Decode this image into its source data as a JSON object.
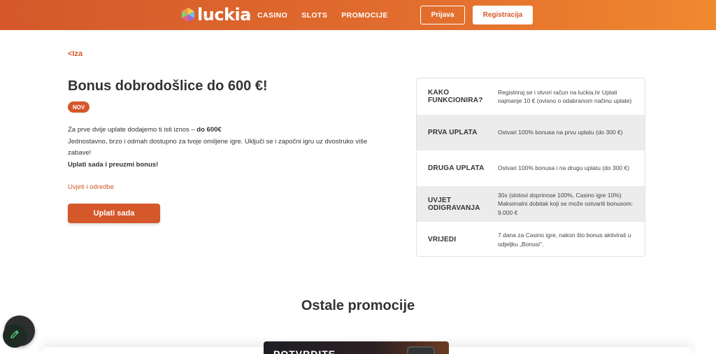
{
  "header": {
    "logo_text": "luckia",
    "nav": [
      {
        "label": "CASINO"
      },
      {
        "label": "SLOTS"
      },
      {
        "label": "PROMOCIJE"
      }
    ],
    "login_label": "Prijava",
    "register_label": "Registracija",
    "colors": {
      "gradient_start": "#d4582a",
      "gradient_end": "#f0892f"
    }
  },
  "main": {
    "back_label": "<Iza",
    "title": "Bonus dobrodošlice do 600 €!",
    "badge": "NOV",
    "description": {
      "line1_text": "Za prve dvije uplate dodajemo ti isti iznos – ",
      "line1_bold": "do 600€",
      "line2": "Jednostavno, brzo i odmah dostupno za tvoje omiljene igre. Uključi se i započni igru uz dvostruko više zabave!",
      "line3_bold": "Uplati sada i preuzmi bonus!"
    },
    "terms_label": "Uvjeti i odredbe",
    "cta_label": "Uplati sada"
  },
  "info_table": [
    {
      "label": "KAKO FUNKCIONIRA?",
      "value": "Registriraj se i otvori račun na luckia.hr Uplati najmanje 10 € (ovisno o odabranom načinu uplate)"
    },
    {
      "label": "PRVA UPLATA",
      "value": "Ostvari 100% bonusa na prvu uplatu (do 300 €)"
    },
    {
      "label": "DRUGA UPLATA",
      "value": "Ostvari 100% bonusa i na drugu uplatu (do 300 €)"
    },
    {
      "label": "UVJET ODIGRAVANJA",
      "value": "30x (slotovi doprinose 100%, Casino igre 10%) Maksimalni dobitak koji se može ostvariti bonusom: 9.000 €"
    },
    {
      "label": "VRIJEDI",
      "value": "7 dana za Casino igre, nakon što bonus aktiviraš u odjeljku „Bonusi\"."
    }
  ],
  "other_promotions": {
    "title": "Ostale promocije",
    "card_text": "POTVRDITE"
  },
  "icons": {
    "fab": "pencil-icon",
    "logo": "luckia-logo-icon"
  }
}
